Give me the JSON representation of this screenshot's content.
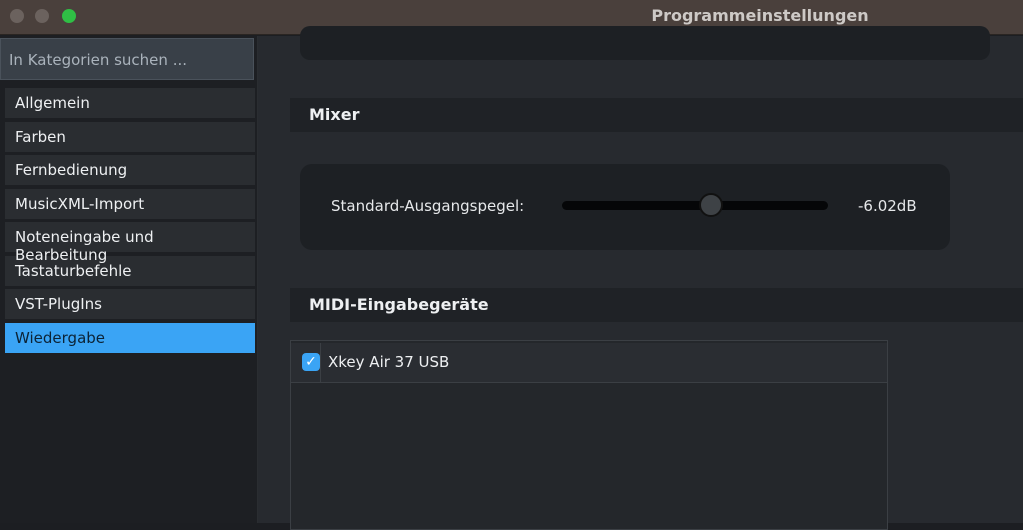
{
  "window": {
    "title": "Programmeinstellungen"
  },
  "sidebar": {
    "search_placeholder": "In Kategorien suchen ...",
    "items": [
      {
        "label": "Allgemein",
        "selected": false
      },
      {
        "label": "Farben",
        "selected": false
      },
      {
        "label": "Fernbedienung",
        "selected": false
      },
      {
        "label": "MusicXML-Import",
        "selected": false
      },
      {
        "label": "Noteneingabe und Bearbeitung",
        "selected": false
      },
      {
        "label": "Tastaturbefehle",
        "selected": false
      },
      {
        "label": "VST-PlugIns",
        "selected": false
      },
      {
        "label": "Wiedergabe",
        "selected": true
      }
    ]
  },
  "mixer": {
    "header": "Mixer",
    "output_label": "Standard-Ausgangspegel:",
    "output_value": "-6.02dB",
    "slider_fraction": 0.56
  },
  "midi": {
    "header": "MIDI-Eingabegeräte",
    "devices": [
      {
        "name": "Xkey Air 37 USB",
        "enabled": true
      }
    ]
  },
  "colors": {
    "accent": "#3aa4f5",
    "close_button": "#6b625e",
    "zoom_button": "#2fbf45"
  }
}
